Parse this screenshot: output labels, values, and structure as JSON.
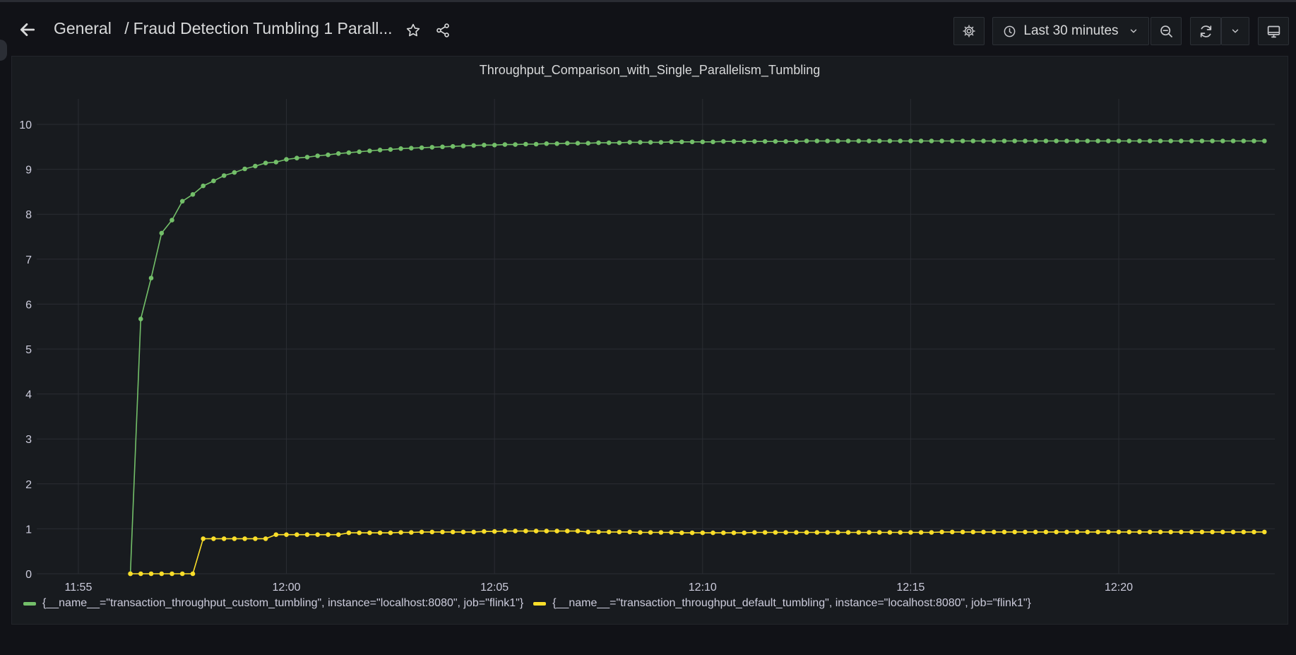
{
  "header": {
    "folder": "General",
    "separator": "/",
    "dashboard_title": "Fraud Detection Tumbling 1 Parall...",
    "time_range_label": "Last 30 minutes"
  },
  "icons": {
    "back": "arrow-left-icon",
    "star": "star-icon",
    "share": "share-icon",
    "settings": "gear-icon",
    "clock": "clock-icon",
    "time_dropdown": "chevron-down-icon",
    "zoom_out": "zoom-out-icon",
    "refresh": "refresh-icon",
    "refresh_dropdown": "chevron-down-icon",
    "tv_mode": "monitor-icon"
  },
  "colors": {
    "background": "#111217",
    "panel": "#181b1f",
    "series_custom": "#73bf69",
    "series_default": "#fade2a"
  },
  "chart_data": {
    "type": "line",
    "title": "Throughput_Comparison_with_Single_Parallelism_Tumbling",
    "xlabel": "",
    "ylabel": "",
    "x_ticks": [
      "11:55",
      "12:00",
      "12:05",
      "12:10",
      "12:15",
      "12:20"
    ],
    "x_tick_minutes": [
      -5,
      0,
      5,
      10,
      15,
      20
    ],
    "x_range_minutes": [
      -6,
      23.75
    ],
    "y_ticks": [
      0,
      1,
      2,
      3,
      4,
      5,
      6,
      7,
      8,
      9,
      10
    ],
    "ylim": [
      0,
      10
    ],
    "grid": true,
    "legend_placement": "bottom-left",
    "x_start_minute": -3.75,
    "x_step_minutes": 0.25,
    "series": [
      {
        "name": "{__name__=\"transaction_throughput_custom_tumbling\", instance=\"localhost:8080\", job=\"flink1\"}",
        "color": "#73bf69",
        "values": [
          0,
          5.67,
          6.58,
          7.58,
          7.87,
          8.29,
          8.44,
          8.63,
          8.74,
          8.86,
          8.93,
          9.01,
          9.07,
          9.14,
          9.16,
          9.22,
          9.25,
          9.27,
          9.3,
          9.32,
          9.35,
          9.37,
          9.39,
          9.41,
          9.43,
          9.44,
          9.46,
          9.47,
          9.48,
          9.49,
          9.5,
          9.51,
          9.52,
          9.53,
          9.54,
          9.54,
          9.55,
          9.55,
          9.56,
          9.56,
          9.57,
          9.57,
          9.58,
          9.58,
          9.58,
          9.59,
          9.59,
          9.59,
          9.6,
          9.6,
          9.6,
          9.6,
          9.61,
          9.61,
          9.61,
          9.61,
          9.61,
          9.62,
          9.62,
          9.62,
          9.62,
          9.62,
          9.62,
          9.62,
          9.62,
          9.63,
          9.63,
          9.63,
          9.63,
          9.63,
          9.63,
          9.63,
          9.63,
          9.63,
          9.63,
          9.63,
          9.63,
          9.63,
          9.63,
          9.63,
          9.63,
          9.63,
          9.63,
          9.63,
          9.63,
          9.63,
          9.63,
          9.63,
          9.63,
          9.63,
          9.63,
          9.63,
          9.63,
          9.63,
          9.63,
          9.63,
          9.63,
          9.63,
          9.63,
          9.63,
          9.63,
          9.63,
          9.63,
          9.63,
          9.63,
          9.63,
          9.63,
          9.63,
          9.63,
          9.63
        ]
      },
      {
        "name": "{__name__=\"transaction_throughput_default_tumbling\", instance=\"localhost:8080\", job=\"flink1\"}",
        "color": "#fade2a",
        "values": [
          0,
          0,
          0,
          0,
          0,
          0,
          0,
          0.78,
          0.78,
          0.78,
          0.78,
          0.78,
          0.78,
          0.78,
          0.87,
          0.87,
          0.87,
          0.87,
          0.87,
          0.87,
          0.87,
          0.91,
          0.91,
          0.91,
          0.91,
          0.91,
          0.92,
          0.92,
          0.93,
          0.93,
          0.93,
          0.93,
          0.93,
          0.93,
          0.94,
          0.94,
          0.95,
          0.95,
          0.95,
          0.95,
          0.95,
          0.95,
          0.95,
          0.95,
          0.93,
          0.93,
          0.93,
          0.93,
          0.93,
          0.92,
          0.92,
          0.92,
          0.92,
          0.91,
          0.91,
          0.91,
          0.91,
          0.91,
          0.91,
          0.91,
          0.92,
          0.92,
          0.92,
          0.92,
          0.92,
          0.92,
          0.92,
          0.92,
          0.92,
          0.92,
          0.92,
          0.92,
          0.92,
          0.92,
          0.92,
          0.92,
          0.92,
          0.92,
          0.93,
          0.93,
          0.93,
          0.93,
          0.93,
          0.93,
          0.93,
          0.93,
          0.93,
          0.93,
          0.93,
          0.93,
          0.93,
          0.93,
          0.93,
          0.93,
          0.93,
          0.93,
          0.93,
          0.93,
          0.93,
          0.93,
          0.93,
          0.93,
          0.93,
          0.93,
          0.93,
          0.93,
          0.93,
          0.93,
          0.93,
          0.93
        ]
      }
    ]
  }
}
